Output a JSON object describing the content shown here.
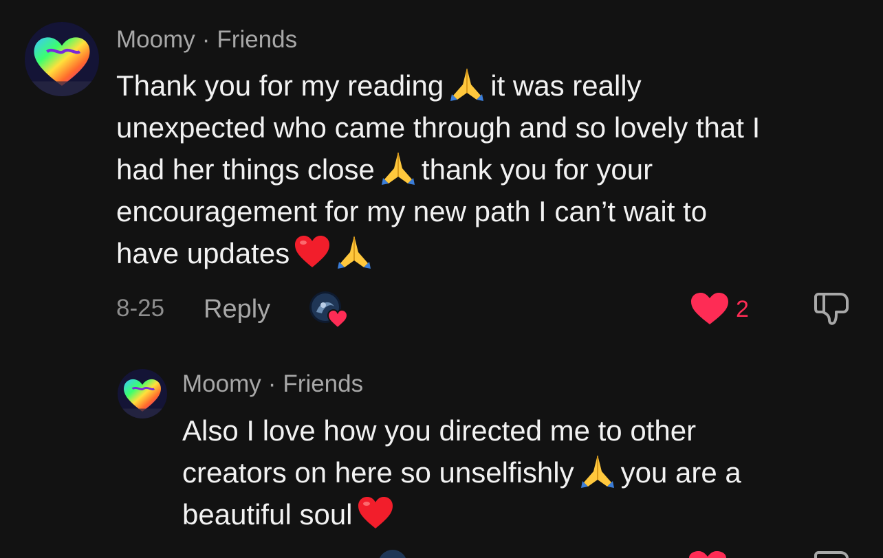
{
  "comments": [
    {
      "username": "Moomy",
      "separator": "·",
      "relation": "Friends",
      "lines": {
        "l1a": "Thank you for my reading",
        "l1b": "it was really",
        "l2": "unexpected who came through and so lovely that I",
        "l3a": "had her things close",
        "l3b": "thank you for your",
        "l4": "encouragement for my new path I can’t wait to",
        "l5": "have updates"
      },
      "date": "8-25",
      "reply_label": "Reply",
      "like_count": "2"
    },
    {
      "username": "Moomy",
      "separator": "·",
      "relation": "Friends",
      "lines": {
        "l1": "Also I love how you directed me to other",
        "l2a": "creators on here so unselfishly",
        "l2b": "you are a",
        "l3": "beautiful soul"
      }
    }
  ],
  "icons": {
    "emoji_pray": "folded-hands-emoji",
    "emoji_heart": "red-heart-emoji",
    "like": "heart-filled-icon",
    "dislike": "thumbs-down-icon",
    "creator_liked": "creator-liked-avatar"
  },
  "colors": {
    "background": "#121212",
    "like_red": "#fe2c55",
    "secondary_text": "#a8a8a8"
  }
}
